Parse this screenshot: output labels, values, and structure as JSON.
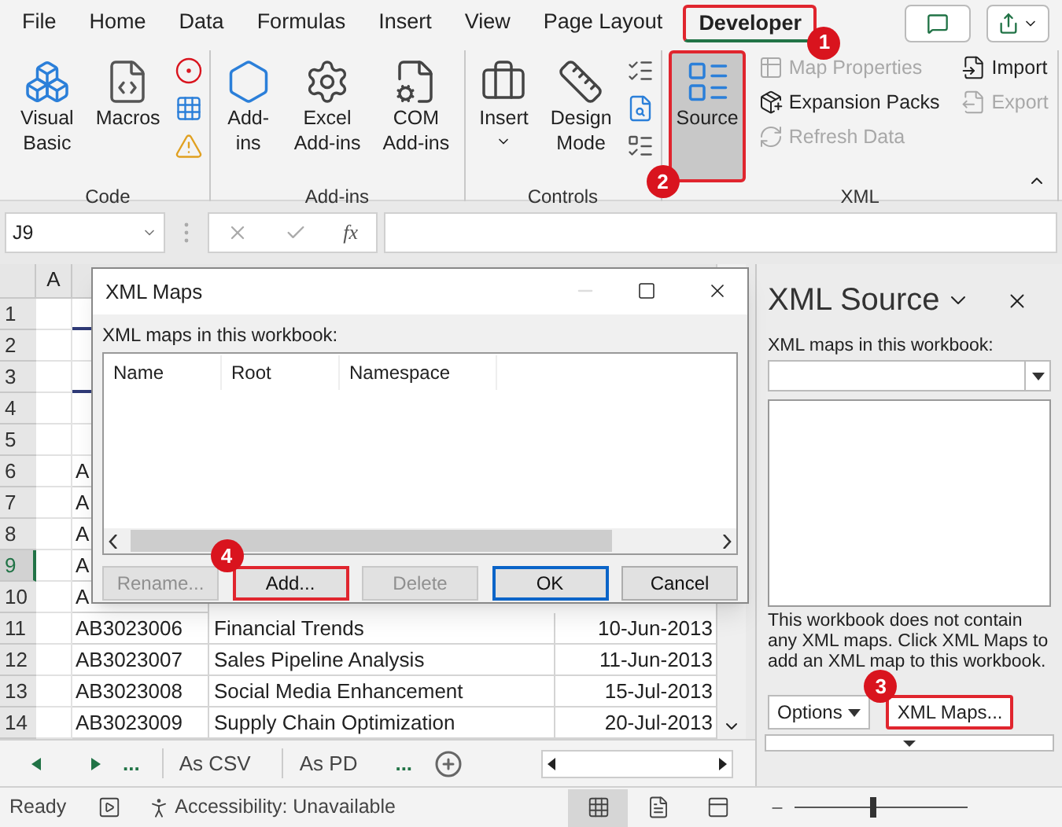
{
  "ribbon_tabs": [
    {
      "label": "File",
      "selected": false,
      "highlighted": false
    },
    {
      "label": "Home",
      "selected": false,
      "highlighted": false
    },
    {
      "label": "Data",
      "selected": false,
      "highlighted": false
    },
    {
      "label": "Formulas",
      "selected": false,
      "highlighted": false
    },
    {
      "label": "Insert",
      "selected": false,
      "highlighted": false
    },
    {
      "label": "View",
      "selected": false,
      "highlighted": false
    },
    {
      "label": "Page Layout",
      "selected": false,
      "highlighted": false
    },
    {
      "label": "Developer",
      "selected": true,
      "highlighted": true,
      "callout": "1"
    }
  ],
  "ribbon_groups": [
    {
      "label": "Code",
      "items": [
        {
          "kind": "large",
          "lines": [
            "Visual",
            "Basic"
          ]
        },
        {
          "kind": "large",
          "lines": [
            "Macros"
          ]
        },
        {
          "kind": "icons"
        }
      ]
    },
    {
      "label": "Add-ins",
      "items": [
        {
          "kind": "large",
          "lines": [
            "Add-",
            "ins"
          ]
        },
        {
          "kind": "large",
          "lines": [
            "Excel",
            "Add-ins"
          ]
        },
        {
          "kind": "large",
          "lines": [
            "COM",
            "Add-ins"
          ]
        }
      ]
    },
    {
      "label": "Controls",
      "items": [
        {
          "kind": "large",
          "lines": [
            "Insert"
          ],
          "dropdown": true
        },
        {
          "kind": "large",
          "lines": [
            "Design",
            "Mode"
          ]
        },
        {
          "kind": "icons"
        }
      ]
    },
    {
      "label": "XML",
      "items": [
        {
          "kind": "large",
          "lines": [
            "Source"
          ],
          "pressed": true,
          "highlighted": true,
          "disabled": false,
          "callout": "2"
        },
        {
          "kind": "small",
          "label": "Map Properties",
          "pressed": false,
          "highlighted": false,
          "disabled": true
        },
        {
          "kind": "small",
          "label": "Expansion Packs",
          "pressed": false,
          "highlighted": false,
          "disabled": false
        },
        {
          "kind": "small",
          "label": "Refresh Data",
          "pressed": false,
          "highlighted": false,
          "disabled": true
        },
        {
          "kind": "small",
          "label": "Import",
          "pressed": false,
          "highlighted": false,
          "disabled": false
        },
        {
          "kind": "small",
          "label": "Export",
          "pressed": false,
          "highlighted": false,
          "disabled": true
        }
      ]
    }
  ],
  "formula_bar": {
    "name_box": "J9",
    "fx_label": "fx"
  },
  "sheet": {
    "columns": [
      "A"
    ],
    "rows": [
      {
        "number": "1",
        "kind": "band",
        "selected": false
      },
      {
        "number": "2",
        "kind": "blank",
        "selected": false
      },
      {
        "number": "3",
        "kind": "band",
        "selected": false
      },
      {
        "number": "4",
        "kind": "blank",
        "selected": false
      },
      {
        "number": "5",
        "kind": "header",
        "selected": false
      },
      {
        "number": "6",
        "kind": "data",
        "selected": false,
        "cells": [
          "A"
        ]
      },
      {
        "number": "7",
        "kind": "data",
        "selected": false,
        "cells": [
          "A"
        ]
      },
      {
        "number": "8",
        "kind": "data",
        "selected": false,
        "cells": [
          "A"
        ]
      },
      {
        "number": "9",
        "kind": "data",
        "selected": true,
        "cells": [
          "A"
        ]
      },
      {
        "number": "10",
        "kind": "data",
        "selected": false,
        "cells": [
          "A"
        ]
      },
      {
        "number": "11",
        "kind": "data",
        "selected": false,
        "cells": [
          "AB3023006",
          "Financial Trends",
          "10-Jun-2013"
        ]
      },
      {
        "number": "12",
        "kind": "data",
        "selected": false,
        "cells": [
          "AB3023007",
          "Sales Pipeline Analysis",
          "11-Jun-2013"
        ]
      },
      {
        "number": "13",
        "kind": "data",
        "selected": false,
        "cells": [
          "AB3023008",
          "Social Media Enhancement",
          "15-Jul-2013"
        ]
      },
      {
        "number": "14",
        "kind": "data",
        "selected": false,
        "cells": [
          "AB3023009",
          "Supply Chain Optimization",
          "20-Jul-2013"
        ]
      }
    ]
  },
  "dialog": {
    "title": "XML Maps",
    "label": "XML maps in this workbook:",
    "columns": [
      "Name",
      "Root",
      "Namespace"
    ],
    "buttons": [
      {
        "label": "Rename...",
        "disabled": true,
        "highlighted": false,
        "default": false
      },
      {
        "label": "Add...",
        "disabled": false,
        "highlighted": true,
        "default": false,
        "callout": "4"
      },
      {
        "label": "Delete",
        "disabled": true,
        "highlighted": false,
        "default": false
      },
      {
        "label": "OK",
        "disabled": false,
        "highlighted": false,
        "default": true
      },
      {
        "label": "Cancel",
        "disabled": false,
        "highlighted": false,
        "default": false
      }
    ]
  },
  "task_pane": {
    "title": "XML Source",
    "label": "XML maps in this workbook:",
    "message": "This workbook does not contain any XML maps. Click XML Maps to add an XML map to this workbook.",
    "buttons": [
      {
        "label": "Options",
        "kind": "dropdown",
        "highlighted": false
      },
      {
        "label": "XML Maps...",
        "kind": "plain",
        "highlighted": true,
        "callout": "3"
      }
    ]
  },
  "sheet_tabs": [
    {
      "kind": "ellipsis",
      "label": "..."
    },
    {
      "kind": "sheet",
      "label": "As CSV"
    },
    {
      "kind": "sheet",
      "label": "As PD"
    },
    {
      "kind": "ellipsis",
      "label": "..."
    }
  ],
  "status_bar": {
    "ready": "Ready",
    "accessibility": "Accessibility: Unavailable",
    "views": [
      {
        "selected": true
      },
      {
        "selected": false
      },
      {
        "selected": false
      }
    ],
    "zoom": {
      "level": 0.45
    }
  }
}
